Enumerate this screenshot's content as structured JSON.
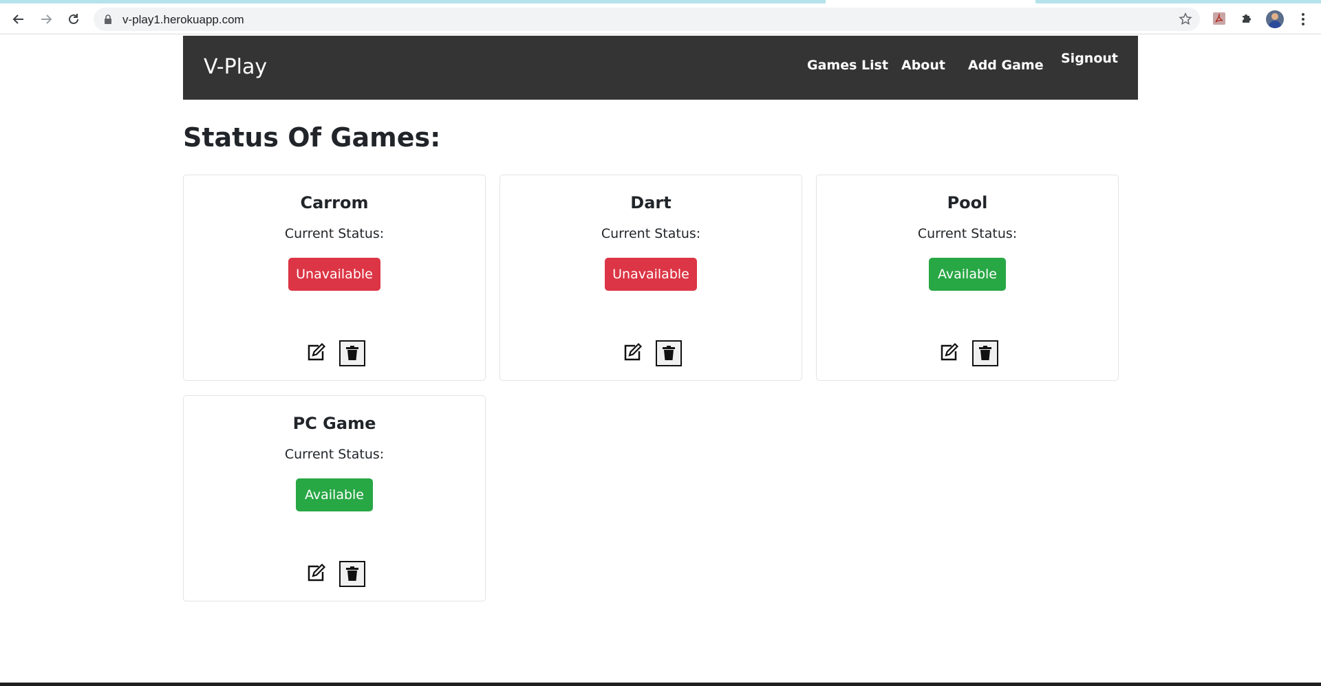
{
  "browser": {
    "url": "v-play1.herokuapp.com"
  },
  "navbar": {
    "brand": "V-Play",
    "links": [
      "Games List",
      "About",
      "Add Game",
      "Signout"
    ]
  },
  "page": {
    "title": "Status Of Games:"
  },
  "games": [
    {
      "name": "Carrom",
      "status_label": "Current Status:",
      "status": "Unavailable",
      "status_color": "#dc3545"
    },
    {
      "name": "Dart",
      "status_label": "Current Status:",
      "status": "Unavailable",
      "status_color": "#dc3545"
    },
    {
      "name": "Pool",
      "status_label": "Current Status:",
      "status": "Available",
      "status_color": "#28a745"
    },
    {
      "name": "PC Game",
      "status_label": "Current Status:",
      "status": "Available",
      "status_color": "#28a745"
    }
  ],
  "colors": {
    "navbar_bg": "#343434",
    "unavailable": "#dc3545",
    "available": "#28a745"
  }
}
